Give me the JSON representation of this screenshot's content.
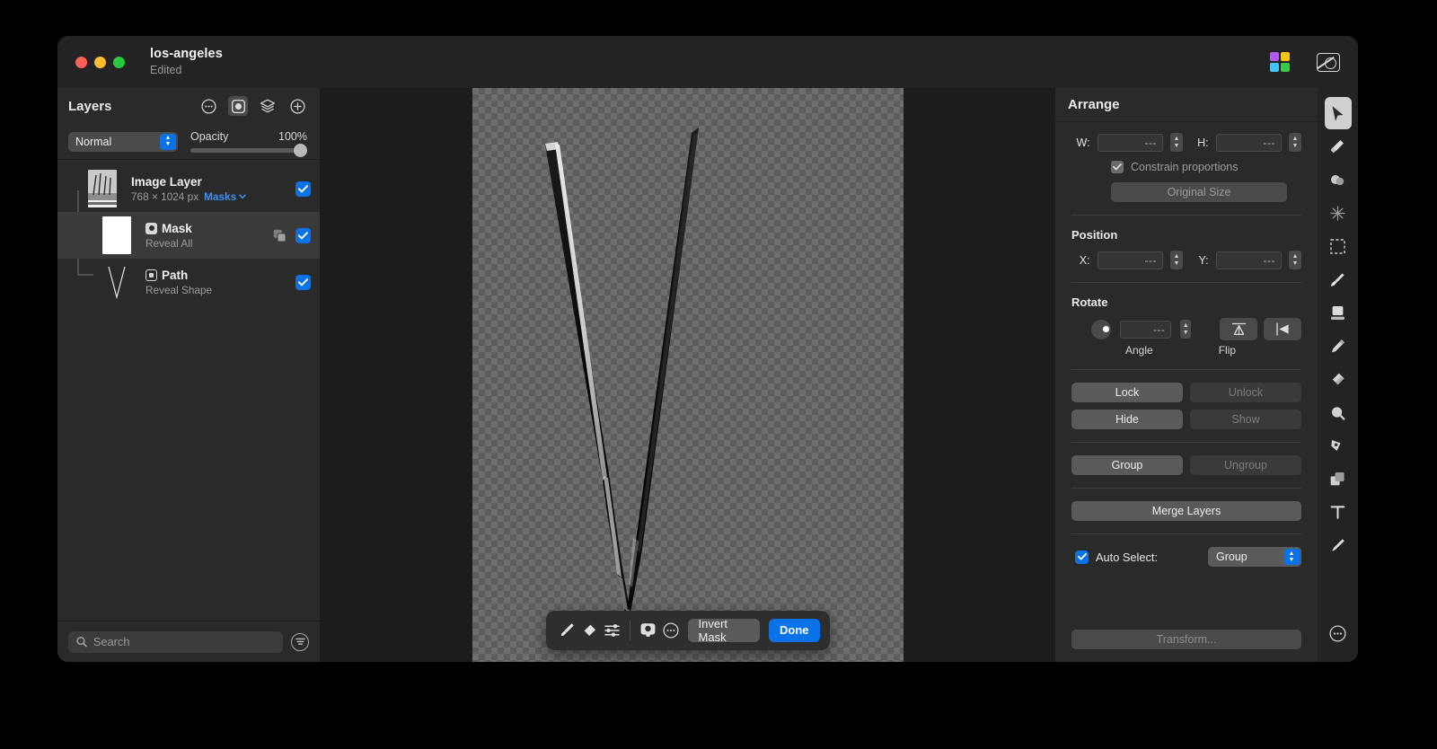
{
  "window": {
    "title": "los-angeles",
    "subtitle": "Edited",
    "traffic_lights": [
      "close",
      "minimize",
      "zoom"
    ],
    "header_icons": [
      {
        "name": "color-grid-icon",
        "colors": [
          "#b15cf0",
          "#f5c518",
          "#45c3f5",
          "#3bc94a"
        ]
      },
      {
        "name": "photo-preview-icon"
      }
    ]
  },
  "layers": {
    "title": "Layers",
    "header_icons": [
      "more-options-icon",
      "mask-icon",
      "stack-icon",
      "add-layer-icon"
    ],
    "blend_mode": "Normal",
    "opacity_label": "Opacity",
    "opacity_value": "100%",
    "opacity_percent": 100,
    "rows": [
      {
        "name": "Image Layer",
        "subtitle": "768 × 1024 px",
        "link": "Masks",
        "thumb": "image",
        "visible": true,
        "selected": false,
        "indent": 0,
        "has_badge": false,
        "duplicate_icon": false
      },
      {
        "name": "Mask",
        "subtitle": "Reveal All",
        "link": "",
        "thumb": "white",
        "visible": true,
        "selected": true,
        "indent": 1,
        "has_badge": true,
        "duplicate_icon": true
      },
      {
        "name": "Path",
        "subtitle": "Reveal Shape",
        "link": "",
        "thumb": "path",
        "visible": true,
        "selected": false,
        "indent": 1,
        "has_badge": true,
        "duplicate_icon": false
      }
    ],
    "search_placeholder": "Search",
    "search_value": "",
    "filter_icon": "filter-icon"
  },
  "canvas": {
    "mask_toolbar": {
      "tools": [
        "brush-icon",
        "eraser-icon",
        "adjustments-icon",
        "subject-mask-icon",
        "more-icon"
      ],
      "invert_label": "Invert Mask",
      "done_label": "Done"
    }
  },
  "arrange": {
    "title": "Arrange",
    "size": {
      "w_label": "W:",
      "w_value": "---",
      "h_label": "H:",
      "h_value": "---",
      "constrain_label": "Constrain proportions",
      "constrain_checked": true,
      "original_size_label": "Original Size",
      "original_size_enabled": false
    },
    "position": {
      "title": "Position",
      "x_label": "X:",
      "x_value": "---",
      "y_label": "Y:",
      "y_value": "---"
    },
    "rotate": {
      "title": "Rotate",
      "angle_value": "---",
      "angle_label": "Angle",
      "flip_label": "Flip",
      "flip_buttons": [
        "flip-vertical-icon",
        "flip-horizontal-icon"
      ]
    },
    "buttons": [
      {
        "label": "Lock",
        "enabled": true
      },
      {
        "label": "Unlock",
        "enabled": false
      },
      {
        "label": "Hide",
        "enabled": true
      },
      {
        "label": "Show",
        "enabled": false
      },
      {
        "label": "Group",
        "enabled": true
      },
      {
        "label": "Ungroup",
        "enabled": false
      }
    ],
    "merge_label": "Merge Layers",
    "auto_select": {
      "label": "Auto Select:",
      "checked": true,
      "value": "Group"
    },
    "transform_label": "Transform..."
  },
  "tools": [
    {
      "name": "move-tool",
      "icon": "cursor-arrow-icon",
      "active": true
    },
    {
      "name": "paint-bucket-tool",
      "icon": "paint-bucket-icon",
      "active": false
    },
    {
      "name": "smudge-tool",
      "icon": "smudge-icon",
      "active": false
    },
    {
      "name": "effects-tool",
      "icon": "sparkle-icon",
      "active": false
    },
    {
      "name": "selection-tool",
      "icon": "marquee-icon",
      "active": false
    },
    {
      "name": "brush-tool",
      "icon": "paintbrush-icon",
      "active": false
    },
    {
      "name": "stamp-tool",
      "icon": "stamp-icon",
      "active": false
    },
    {
      "name": "pencil-tool",
      "icon": "pencil-icon",
      "active": false
    },
    {
      "name": "eraser-tool",
      "icon": "eraser-icon",
      "active": false
    },
    {
      "name": "clone-tool",
      "icon": "clone-icon",
      "active": false
    },
    {
      "name": "pen-tool",
      "icon": "pen-nib-icon",
      "active": false
    },
    {
      "name": "shapes-tool",
      "icon": "shapes-icon",
      "active": false
    },
    {
      "name": "text-tool",
      "icon": "text-t-icon",
      "active": false
    },
    {
      "name": "draw-tool",
      "icon": "fountain-pen-icon",
      "active": false
    }
  ],
  "tools_more": {
    "name": "more-tools",
    "icon": "more-icon"
  }
}
